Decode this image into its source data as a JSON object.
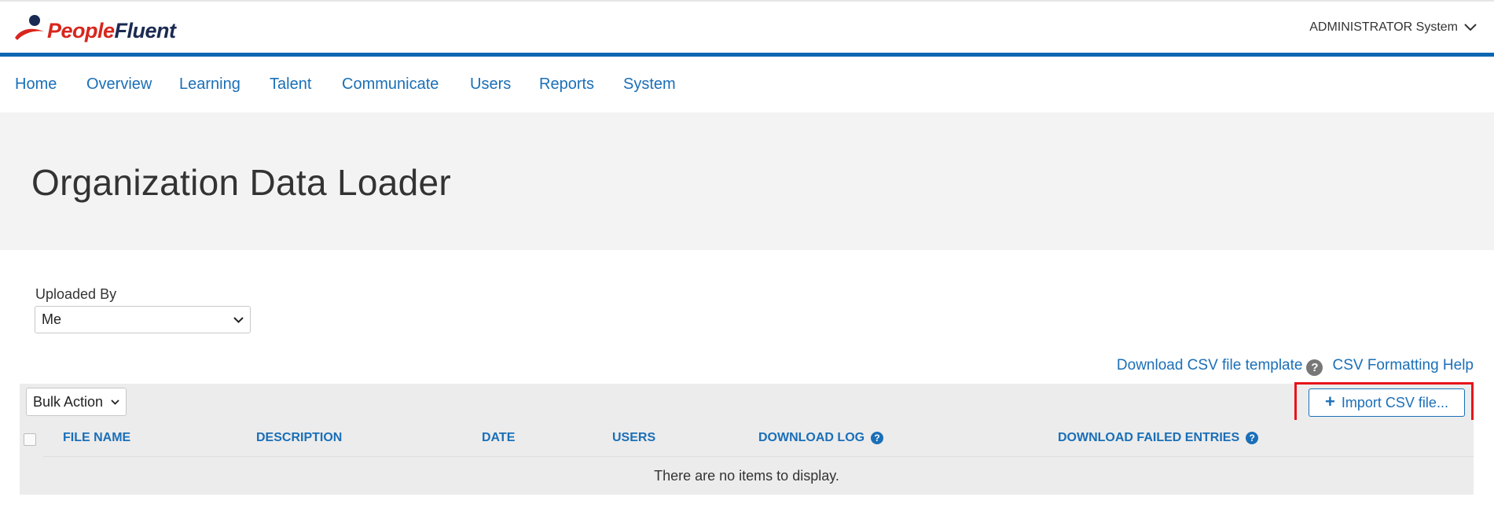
{
  "brand": {
    "logo_part1": "People",
    "logo_part2": "Fluent"
  },
  "user_menu": {
    "label": "ADMINISTRATOR System",
    "icon": "chevron-down-icon"
  },
  "nav": {
    "items": [
      {
        "label": "Home"
      },
      {
        "label": "Overview"
      },
      {
        "label": "Learning"
      },
      {
        "label": "Talent"
      },
      {
        "label": "Communicate"
      },
      {
        "label": "Users"
      },
      {
        "label": "Reports"
      },
      {
        "label": "System"
      }
    ]
  },
  "page": {
    "title": "Organization Data Loader"
  },
  "filter": {
    "label": "Uploaded By",
    "selected": "Me"
  },
  "links": {
    "download_template": "Download CSV file template",
    "formatting_help": "CSV Formatting Help",
    "help_icon": "question-circle-icon"
  },
  "toolbar": {
    "bulk_action": "Bulk Action",
    "import_label": "Import CSV file..."
  },
  "table": {
    "columns": [
      "FILE NAME",
      "DESCRIPTION",
      "DATE",
      "USERS",
      "DOWNLOAD LOG",
      "DOWNLOAD FAILED ENTRIES"
    ],
    "empty_message": "There are no items to display."
  },
  "colors": {
    "accent": "#1a6fb8",
    "brand_red": "#d8261d",
    "brand_navy": "#1b2a52",
    "highlight": "#e8131b"
  }
}
